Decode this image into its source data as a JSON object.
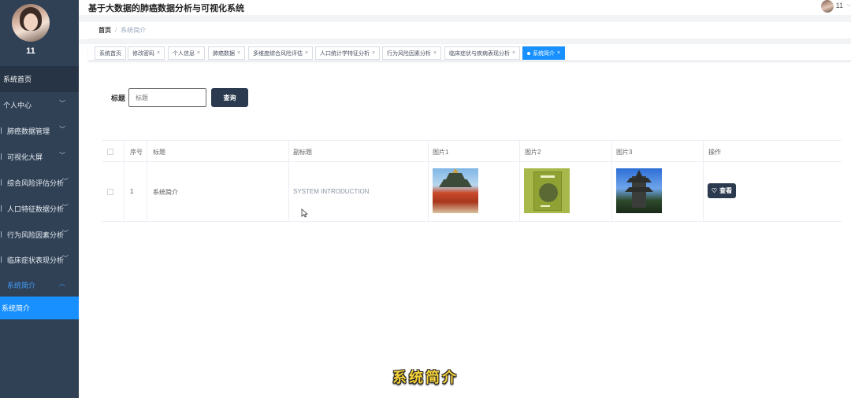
{
  "app": {
    "title": "基于大数据的肺癌数据分析与可视化系统",
    "user": "11"
  },
  "sidebar": {
    "username": "11",
    "home": "系统首页",
    "items": [
      {
        "label": "个人中心"
      },
      {
        "label": "肺癌数据管理"
      },
      {
        "label": "可视化大屏"
      },
      {
        "label": "综合风险评估分析"
      },
      {
        "label": "人口特征数据分析"
      },
      {
        "label": "行为风险因素分析"
      },
      {
        "label": "临床症状表现分析"
      },
      {
        "label": "系统简介"
      }
    ],
    "active_sub": "系统简介"
  },
  "breadcrumb": {
    "home": "首页",
    "separator": "/",
    "current": "系统简介"
  },
  "tags": [
    {
      "label": "系统首页"
    },
    {
      "label": "修改密码"
    },
    {
      "label": "个人信息"
    },
    {
      "label": "肺癌数据"
    },
    {
      "label": "多维度综合风险评估"
    },
    {
      "label": "人口统计学特征分析"
    },
    {
      "label": "行为风险因素分析"
    },
    {
      "label": "临床症状与疾病表现分析"
    },
    {
      "label": "系统简介"
    }
  ],
  "tag_close": "×",
  "search": {
    "label": "标题",
    "placeholder": "标题",
    "button": "查询"
  },
  "table": {
    "headers": [
      "序号",
      "标题",
      "副标题",
      "图片1",
      "图片2",
      "图片3",
      "操作"
    ],
    "rows": [
      {
        "index": "1",
        "title": "系统简介",
        "subtitle": "SYSTEM INTRODUCTION"
      }
    ],
    "action_label": "查看"
  },
  "caption": "系统简介",
  "colors": {
    "sidebar_bg": "#304156",
    "accent": "#1890ff",
    "button_dark": "#2b3a4f",
    "caption": "#f5d23a"
  },
  "icons": {
    "chevron_down": "chevron-down-icon",
    "chevron_up": "chevron-up-icon",
    "heart": "heart-icon",
    "close": "close-icon"
  }
}
